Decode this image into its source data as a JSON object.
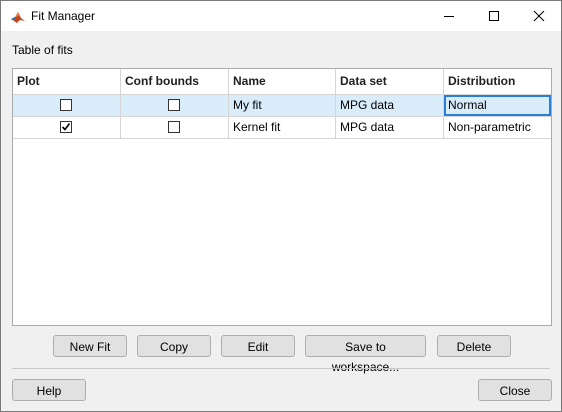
{
  "window": {
    "title": "Fit Manager"
  },
  "section": {
    "label": "Table of fits"
  },
  "table": {
    "columns": [
      "Plot",
      "Conf bounds",
      "Name",
      "Data set",
      "Distribution"
    ],
    "rows": [
      {
        "plot": false,
        "conf_bounds": false,
        "name": "My fit",
        "data_set": "MPG data",
        "distribution": "Normal",
        "selected": true
      },
      {
        "plot": true,
        "conf_bounds": false,
        "name": "Kernel fit",
        "data_set": "MPG data",
        "distribution": "Non-parametric",
        "selected": false
      }
    ]
  },
  "actions": {
    "new_fit": "New Fit",
    "copy": "Copy",
    "edit": "Edit",
    "save": "Save to workspace...",
    "delete": "Delete"
  },
  "footer": {
    "help": "Help",
    "close": "Close"
  },
  "colors": {
    "selection": "#d8ecfa",
    "focus_border": "#2a7fd4",
    "button_face": "#e1e1e1"
  }
}
